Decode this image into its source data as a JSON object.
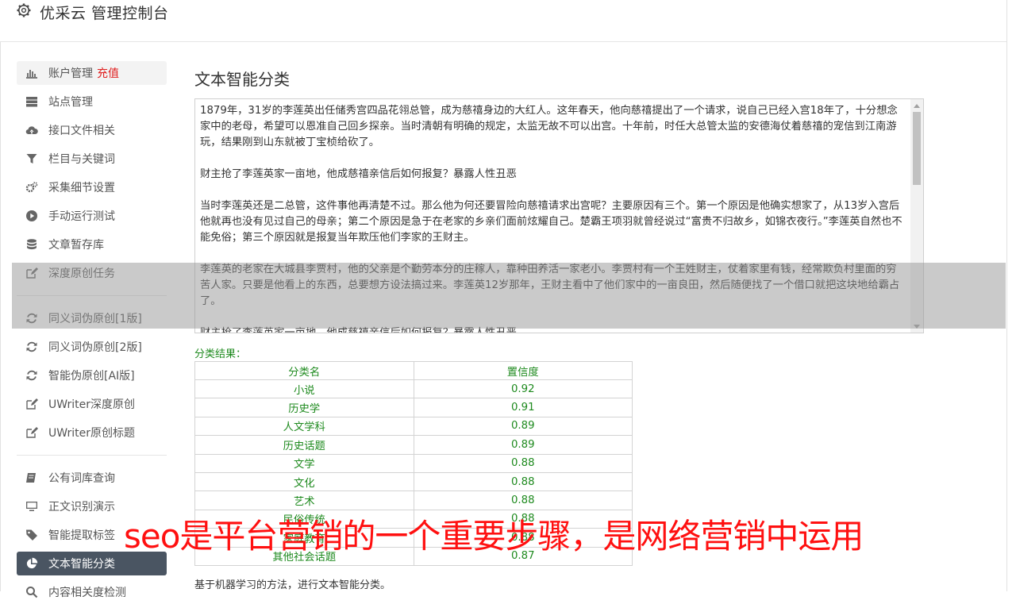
{
  "app": {
    "title": "优采云 管理控制台"
  },
  "sidebar": {
    "items": [
      {
        "label": "账户管理",
        "extra": "充值",
        "icon": "bar-chart-icon"
      },
      {
        "label": "站点管理",
        "icon": "server-icon"
      },
      {
        "label": "接口文件相关",
        "icon": "cloud-upload-icon"
      },
      {
        "label": "栏目与关键词",
        "icon": "filter-icon"
      },
      {
        "label": "采集细节设置",
        "icon": "gears-icon"
      },
      {
        "label": "手动运行测试",
        "icon": "play-circle-icon"
      },
      {
        "label": "文章暂存库",
        "icon": "database-icon"
      },
      {
        "label": "深度原创任务",
        "icon": "edit-icon"
      },
      {
        "label": "同义词伪原创[1版]",
        "icon": "refresh-icon"
      },
      {
        "label": "同义词伪原创[2版]",
        "icon": "refresh-icon"
      },
      {
        "label": "智能伪原创[AI版]",
        "icon": "refresh-icon"
      },
      {
        "label": "UWriter深度原创",
        "icon": "edit-icon"
      },
      {
        "label": "UWriter原创标题",
        "icon": "edit-icon"
      },
      {
        "label": "公有词库查询",
        "icon": "book-icon"
      },
      {
        "label": "正文识别演示",
        "icon": "monitor-icon"
      },
      {
        "label": "智能提取标签",
        "icon": "tag-icon"
      },
      {
        "label": "文本智能分类",
        "icon": "pie-chart-icon"
      },
      {
        "label": "内容相关度检测",
        "icon": "search-icon"
      }
    ]
  },
  "main": {
    "title": "文本智能分类",
    "text_content": "1879年，31岁的李莲英出任储秀宫四品花翎总管，成为慈禧身边的大红人。这年春天，他向慈禧提出了一个请求，说自己已经入宫18年了，十分想念家中的老母，希望可以恩准自己回乡探亲。当时清朝有明确的规定，太监无故不可以出宫。十年前，时任大总管太监的安德海仗着慈禧的宠信到江南游玩，结果刚到山东就被丁宝桢给砍了。\n\n财主抢了李莲英家一亩地，他成慈禧亲信后如何报复？暴露人性丑恶\n\n当时李莲英还是二总管，这件事他再清楚不过。那么他为何还要冒险向慈禧请求出宫呢？主要原因有三个。第一个原因是他确实想家了，从13岁入宫后他就再也没有见过自己的母亲；第二个原因是急于在老家的乡亲们面前炫耀自己。楚霸王项羽就曾经说过“富贵不归故乡，如锦衣夜行。”李莲英自然也不能免俗；第三个原因就是报复当年欺压他们李家的王财主。\n\n李莲英的老家在大城县李贾村，他的父亲是个勤劳本分的庄稼人，靠种田养活一家老小。李贾村有一个王姓财主，仗着家里有钱，经常欺负村里面的穷苦人家。只要是他看上的东西，总要想方设法搞过来。李莲英12岁那年，王财主看中了他们家中的一亩良田，然后随便找了一个借口就把这块地给霸占了。\n\n财主抢了李莲英家一亩地，他成慈禧亲信后如何报复？暴露人性丑恶",
    "result_label": "分类结果：",
    "table": {
      "headers": [
        "分类名",
        "置信度"
      ],
      "rows": [
        [
          "小说",
          "0.92"
        ],
        [
          "历史学",
          "0.91"
        ],
        [
          "人文学科",
          "0.89"
        ],
        [
          "历史话题",
          "0.89"
        ],
        [
          "文学",
          "0.88"
        ],
        [
          "文化",
          "0.88"
        ],
        [
          "艺术",
          "0.88"
        ],
        [
          "民俗传统",
          "0.88"
        ],
        [
          "家庭教育",
          "0.88"
        ],
        [
          "其他社会话题",
          "0.87"
        ]
      ]
    },
    "footnote": "基于机器学习的方法，进行文本智能分类。"
  },
  "overlay": {
    "caption": "seo是平台营销的一个重要步骤，是网络营销中运用"
  },
  "colors": {
    "active_nav": "#4a5562",
    "result_green": "#1e8a1e",
    "accent_red": "#e02020",
    "caption_red": "#ff1010"
  }
}
